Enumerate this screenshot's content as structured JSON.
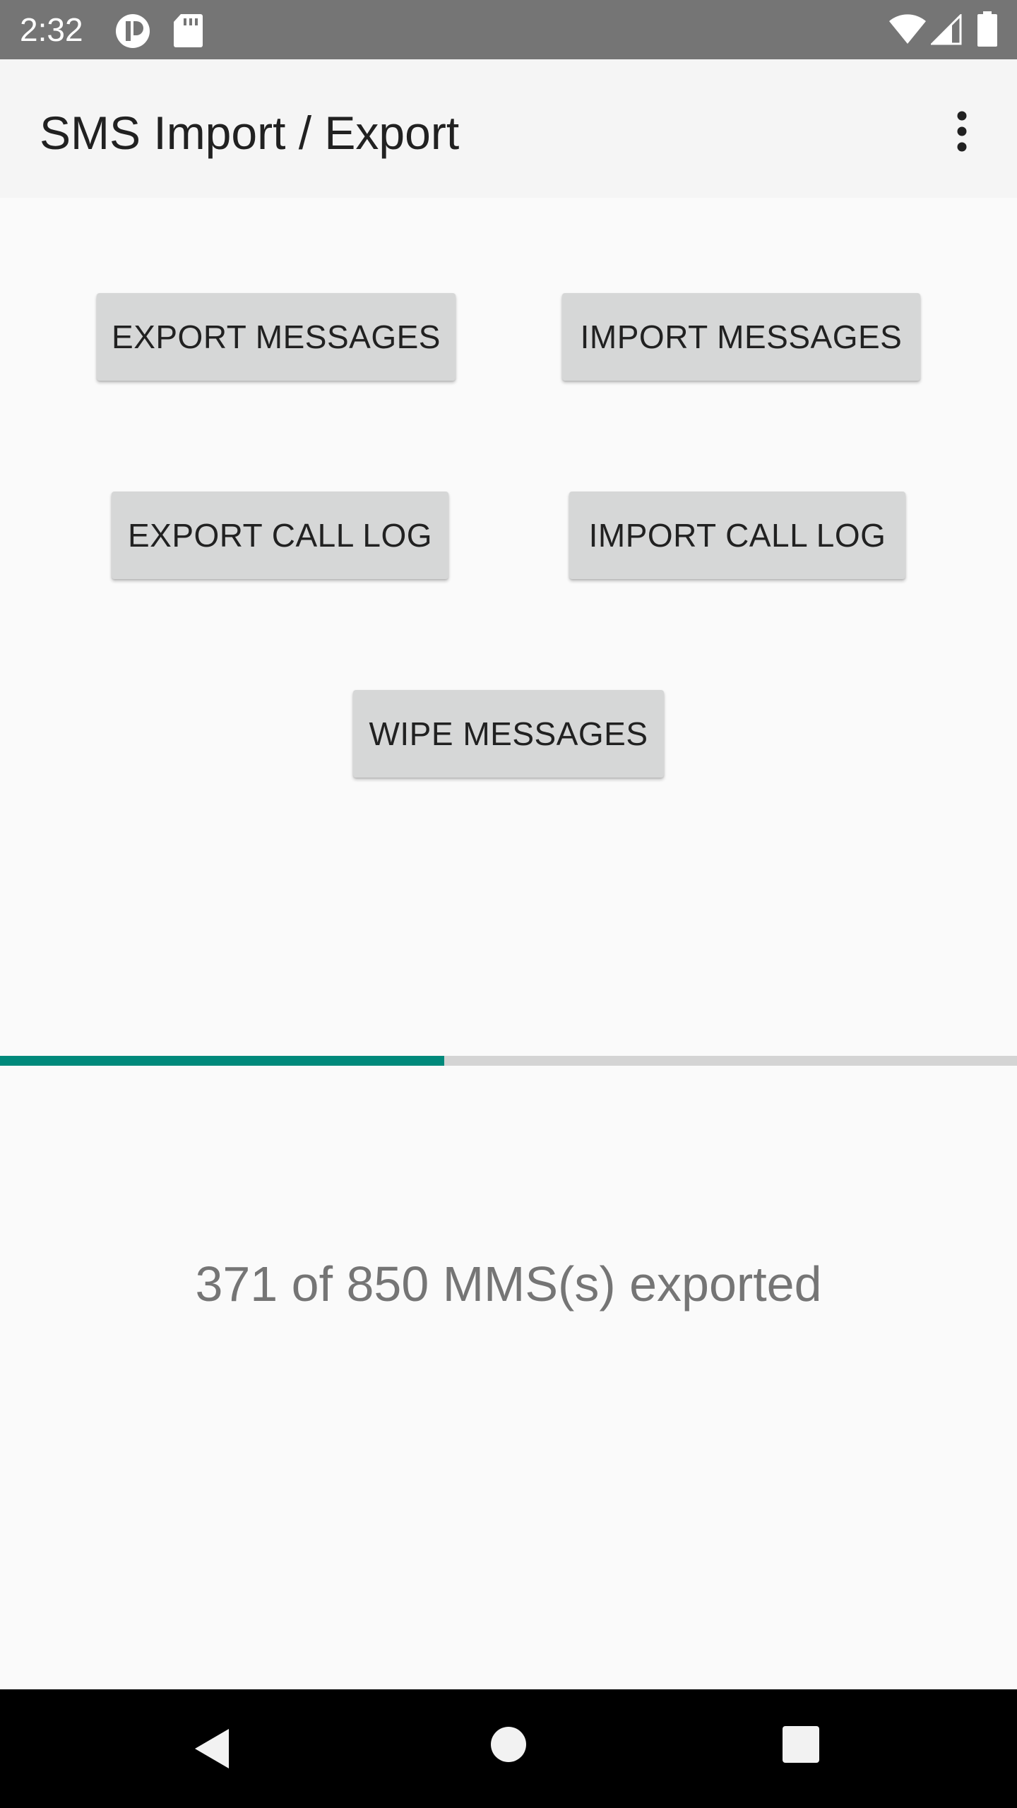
{
  "status_bar": {
    "time": "2:32",
    "icons": [
      "notification-app-icon",
      "sd-card-icon",
      "wifi-icon",
      "cell-signal-icon",
      "battery-icon"
    ]
  },
  "app_bar": {
    "title": "SMS Import / Export",
    "overflow_icon": "more-vert-icon"
  },
  "buttons": {
    "export_messages": "EXPORT MESSAGES",
    "import_messages": "IMPORT MESSAGES",
    "export_call_log": "EXPORT CALL LOG",
    "import_call_log": "IMPORT CALL LOG",
    "wipe_messages": "WIPE MESSAGES"
  },
  "progress": {
    "fraction": 0.4365,
    "fill_color": "#00897b",
    "track_color": "#d4d4d4"
  },
  "status_message": "371 of 850 MMS(s) exported",
  "nav_bar": {
    "icons": [
      "back-icon",
      "home-icon",
      "recents-icon"
    ]
  },
  "colors": {
    "status_bar": "#757575",
    "app_bar": "#f5f5f5",
    "background": "#fafafa",
    "button": "#d6d7d7",
    "accent": "#00897b"
  }
}
